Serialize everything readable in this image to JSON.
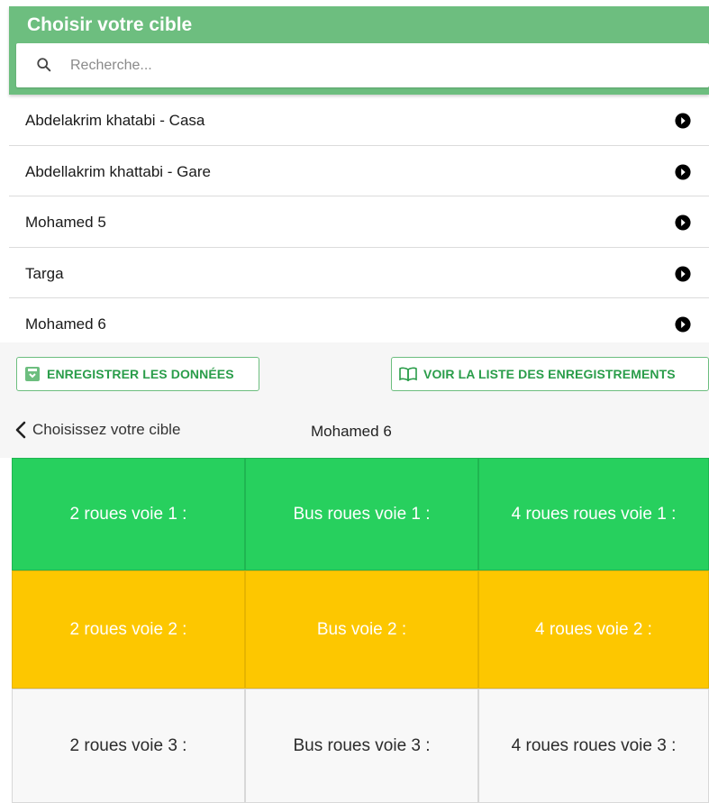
{
  "header": {
    "title": "Choisir votre cible",
    "search_placeholder": "Recherche...",
    "search_value": ""
  },
  "targets": [
    {
      "label": "Abdelakrim khatabi - Casa"
    },
    {
      "label": "Abdellakrim khattabi - Gare"
    },
    {
      "label": "Mohamed 5"
    },
    {
      "label": "Targa"
    },
    {
      "label": "Mohamed 6"
    }
  ],
  "actions": {
    "save_label": "ENREGISTRER LES DONNÉES",
    "list_label": "VOIR LA LISTE DES ENREGISTREMENTS"
  },
  "subnav": {
    "back_label": "Choisissez votre cible",
    "selected_target": "Mohamed 6"
  },
  "grid": {
    "rows": [
      [
        "2 roues voie 1 :",
        "Bus roues voie 1 :",
        "4 roues roues voie 1 :"
      ],
      [
        "2 roues voie 2 :",
        "Bus voie 2 :",
        "4 roues voie 2 :"
      ],
      [
        "2 roues voie 3 :",
        "Bus roues voie 3 :",
        "4 roues roues voie 3 :"
      ]
    ]
  },
  "colors": {
    "header": "#6dbe7f",
    "accent_green": "#2a9d4a",
    "row1": "#27d05e",
    "row2": "#fdc700",
    "row3": "#f8f8f8"
  },
  "icons": {
    "search": "search-icon",
    "list_item": "play-circle-icon",
    "save": "save-icon",
    "list": "book-icon",
    "back": "chevron-left-icon"
  }
}
